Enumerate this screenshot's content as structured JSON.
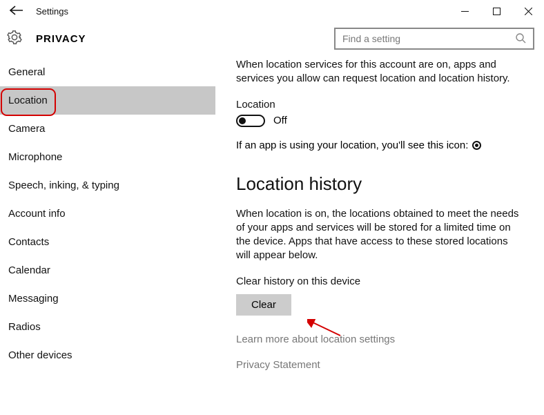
{
  "titlebar": {
    "title": "Settings"
  },
  "header": {
    "privacy": "PRIVACY",
    "searchPlaceholder": "Find a setting"
  },
  "sidebar": {
    "items": [
      {
        "label": "General"
      },
      {
        "label": "Location"
      },
      {
        "label": "Camera"
      },
      {
        "label": "Microphone"
      },
      {
        "label": "Speech, inking, & typing"
      },
      {
        "label": "Account info"
      },
      {
        "label": "Contacts"
      },
      {
        "label": "Calendar"
      },
      {
        "label": "Messaging"
      },
      {
        "label": "Radios"
      },
      {
        "label": "Other devices"
      }
    ]
  },
  "content": {
    "intro": "When location services for this account are on, apps and services you allow can request location and location history.",
    "locationLabel": "Location",
    "toggleState": "Off",
    "iconLine": "If an app is using your location, you'll see this icon:",
    "historyHeading": "Location history",
    "historyPara": "When location is on, the locations obtained to meet the needs of your apps and services will be stored for a limited time on the device. Apps that have access to these stored locations will appear below.",
    "clearLabel": "Clear history on this device",
    "clearButton": "Clear",
    "learnMore": "Learn more about location settings",
    "privacyStatement": "Privacy Statement"
  }
}
